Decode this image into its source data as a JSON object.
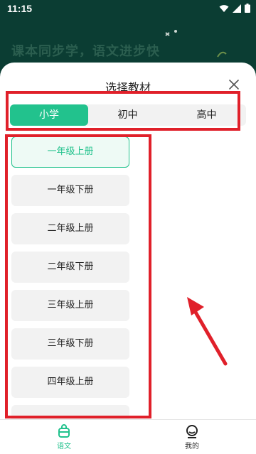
{
  "status_bar": {
    "time": "11:15"
  },
  "banner": {
    "slogan": "课本同步学，语文进步快"
  },
  "sheet": {
    "title": "选择教材",
    "close_icon": "close-icon"
  },
  "tabs": [
    {
      "label": "小学",
      "active": true
    },
    {
      "label": "初中",
      "active": false
    },
    {
      "label": "高中",
      "active": false
    }
  ],
  "grades": [
    {
      "label": "一年级上册",
      "selected": true
    },
    {
      "label": "一年级下册",
      "selected": false
    },
    {
      "label": "二年级上册",
      "selected": false
    },
    {
      "label": "二年级下册",
      "selected": false
    },
    {
      "label": "三年级上册",
      "selected": false
    },
    {
      "label": "三年级下册",
      "selected": false
    },
    {
      "label": "四年级上册",
      "selected": false
    }
  ],
  "bottom_nav": [
    {
      "label": "语文",
      "icon": "book-bag-icon",
      "active": true
    },
    {
      "label": "我的",
      "icon": "profile-icon",
      "active": false
    }
  ],
  "colors": {
    "accent": "#22c28d",
    "header_bg": "#0b3d33",
    "annotation": "#e0202a"
  }
}
